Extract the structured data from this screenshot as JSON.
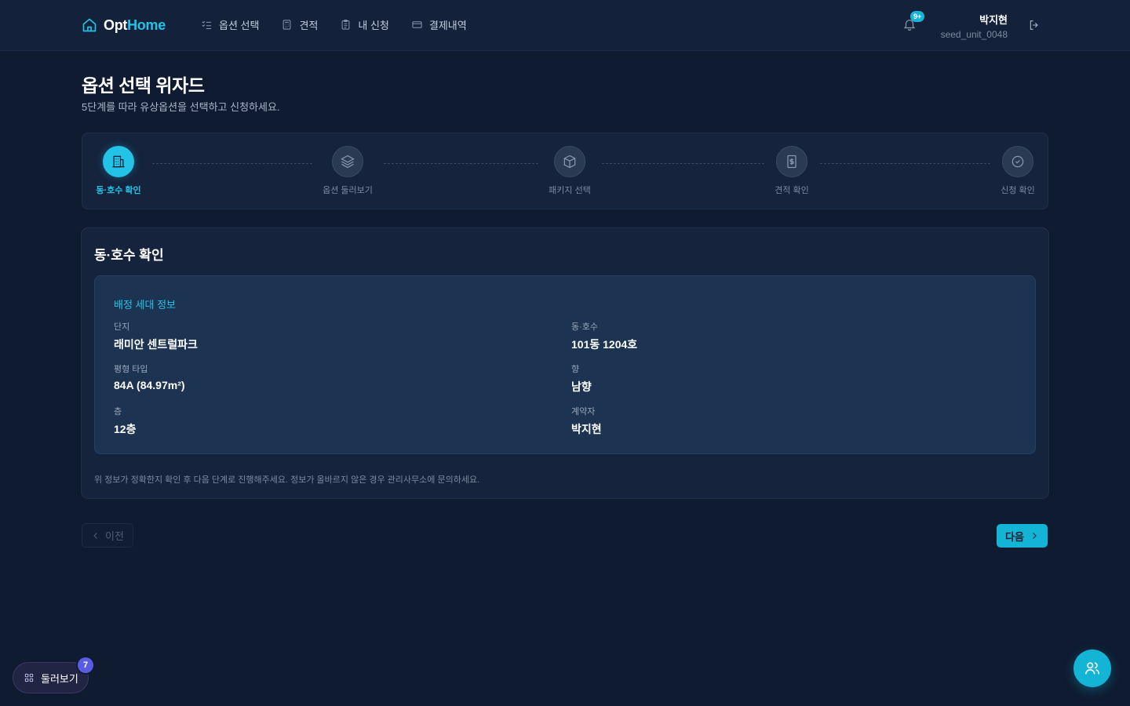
{
  "brand": {
    "name_part1": "Opt",
    "name_part2": "Home",
    "icon": "home-icon",
    "accent_color": "#22c3e6"
  },
  "nav": {
    "items": [
      {
        "label": "옵션 선택",
        "icon": "checklist-icon"
      },
      {
        "label": "견적",
        "icon": "calculator-icon"
      },
      {
        "label": "내 신청",
        "icon": "clipboard-icon"
      },
      {
        "label": "결제내역",
        "icon": "credit-card-icon"
      }
    ]
  },
  "notifications": {
    "badge": "9+",
    "icon": "bell-icon"
  },
  "user": {
    "name": "박지현",
    "id": "seed_unit_0048",
    "logout_icon": "logout-icon"
  },
  "page": {
    "title": "옵션 선택 위자드",
    "subtitle": "5단계를 따라 유상옵션을 선택하고 신청하세요."
  },
  "steps": [
    {
      "label": "동·호수 확인",
      "icon": "building-icon",
      "active": true
    },
    {
      "label": "옵션 둘러보기",
      "icon": "layers-icon",
      "active": false
    },
    {
      "label": "패키지 선택",
      "icon": "package-icon",
      "active": false
    },
    {
      "label": "견적 확인",
      "icon": "receipt-icon",
      "active": false
    },
    {
      "label": "신청 확인",
      "icon": "check-circle-icon",
      "active": false
    }
  ],
  "card": {
    "title": "동·호수 확인",
    "info_heading": "배정 세대 정보",
    "fields": {
      "complex": {
        "label": "단지",
        "value": "래미안 센트럴파크"
      },
      "unit": {
        "label": "동·호수",
        "value": "101동 1204호"
      },
      "type": {
        "label": "평형 타입",
        "value": "84A (84.97m²)"
      },
      "direction": {
        "label": "향",
        "value": "남향"
      },
      "floor": {
        "label": "층",
        "value": "12층"
      },
      "contractor": {
        "label": "계약자",
        "value": "박지현"
      }
    },
    "note": "위 정보가 정확한지 확인 후 다음 단계로 진행해주세요. 정보가 올바르지 않은 경우 관리사무소에 문의하세요."
  },
  "actions": {
    "prev_label": "이전",
    "next_label": "다음"
  },
  "floating": {
    "browse_label": "둘러보기",
    "browse_badge": "7",
    "fab_icon": "users-icon"
  }
}
